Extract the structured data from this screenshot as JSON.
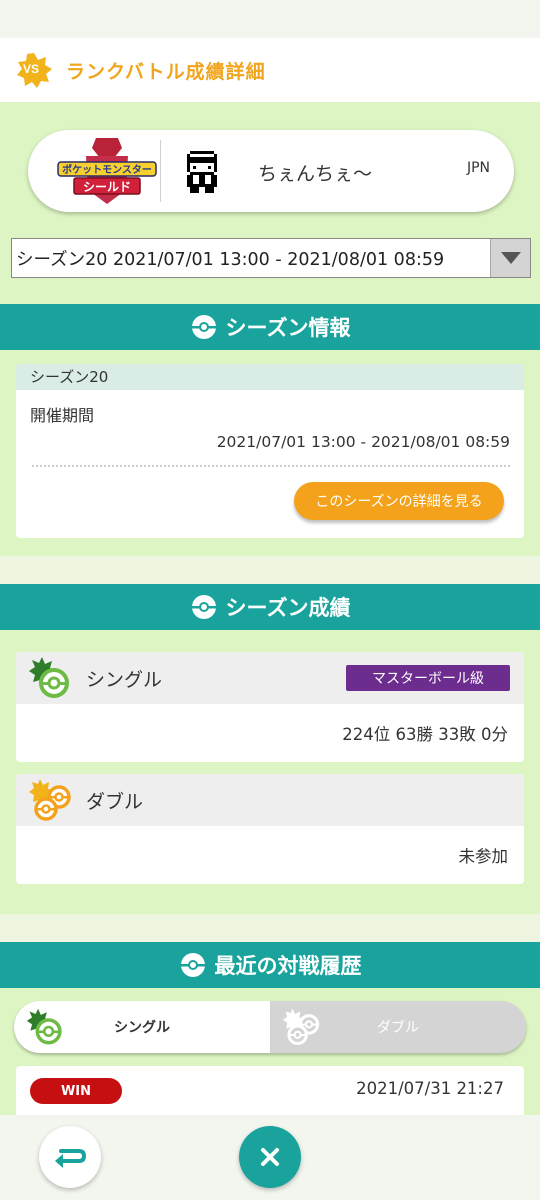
{
  "header": {
    "vs_text": "VS",
    "title": "ランクバトル成績詳細"
  },
  "trainer": {
    "game_logo_top": "ポケットモンスター",
    "game_logo_bottom": "シールド",
    "name": "ちぇんちぇ～",
    "region": "JPN"
  },
  "season_select": {
    "selected": "シーズン20 2021/07/01 13:00 - 2021/08/01 08:59"
  },
  "season_info": {
    "section_title": "シーズン情報",
    "season_name": "シーズン20",
    "period_label": "開催期間",
    "period_value": "2021/07/01 13:00 - 2021/08/01 08:59",
    "detail_button": "このシーズンの詳細を見る"
  },
  "season_results": {
    "section_title": "シーズン成績",
    "single": {
      "label": "シングル",
      "rank_badge": "マスターボール級",
      "result": "224位 63勝 33敗 0分"
    },
    "double": {
      "label": "ダブル",
      "result": "未参加"
    }
  },
  "recent_battles": {
    "section_title": "最近の対戦履歴",
    "tabs": [
      {
        "label": "シングル",
        "active": true
      },
      {
        "label": "ダブル",
        "active": false
      }
    ],
    "entries": [
      {
        "result": "WIN",
        "datetime": "2021/07/31 21:27"
      }
    ]
  },
  "colors": {
    "teal": "#1aa39c",
    "orange": "#f4a21b",
    "light_green": "#ddf5c3",
    "master_ball_purple": "#6c2d8f",
    "win_red": "#c60f10"
  }
}
